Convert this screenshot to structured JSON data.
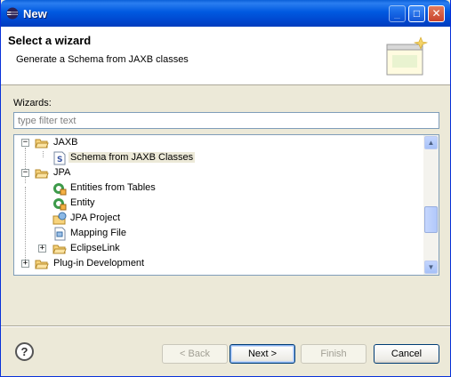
{
  "window": {
    "title": "New"
  },
  "header": {
    "title": "Select a wizard",
    "description": "Generate a Schema from JAXB classes"
  },
  "wizards": {
    "label": "Wizards:",
    "filter_placeholder": "type filter text"
  },
  "tree": [
    {
      "label": "JAXB",
      "icon": "folder-icon",
      "expanded": true
    },
    {
      "label": "Schema from JAXB Classes",
      "icon": "schema-icon",
      "selected": true
    },
    {
      "label": "JPA",
      "icon": "folder-icon",
      "expanded": true
    },
    {
      "label": "Entities from Tables",
      "icon": "jpa-entities-icon"
    },
    {
      "label": "Entity",
      "icon": "jpa-entity-icon"
    },
    {
      "label": "JPA Project",
      "icon": "jpa-project-icon"
    },
    {
      "label": "Mapping File",
      "icon": "mapping-file-icon"
    },
    {
      "label": "EclipseLink",
      "icon": "folder-icon",
      "expanded": false
    },
    {
      "label": "Plug-in Development",
      "icon": "folder-icon",
      "expanded": false
    }
  ],
  "buttons": {
    "help": "?",
    "back": "< Back",
    "next": "Next >",
    "finish": "Finish",
    "cancel": "Cancel"
  },
  "colors": {
    "titlebar": "#0059e0",
    "dialog_bg": "#ece9d8"
  }
}
